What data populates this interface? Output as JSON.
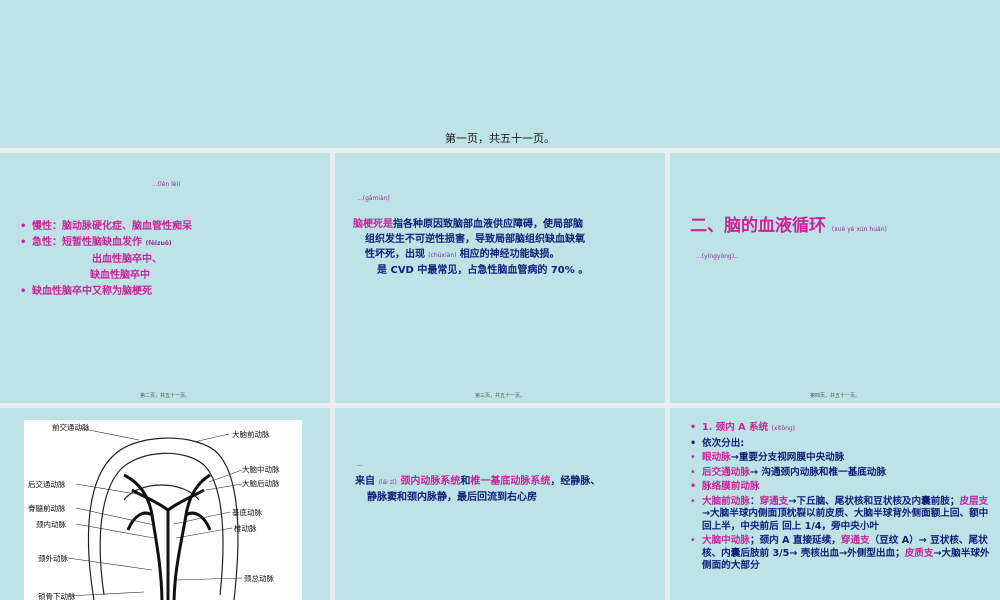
{
  "top": {
    "caption": "第一页，共五十一页。"
  },
  "slide1": {
    "note": "...(lèn lèi)",
    "items": [
      "慢性：脑动脉硬化症、脑血管性痴呆",
      "急性：短暂性脑缺血发作",
      "出血性脑卒中、",
      "缺血性脑卒中",
      "缺血性脑卒中又称为脑梗死"
    ],
    "pinyin": "(fēizuō)",
    "footer": "第二页，共五十一页。"
  },
  "slide2": {
    "note": "...(gāmiàn)",
    "term": "脑梗死是",
    "line1": "指各种原因致脑部血液供应障碍，使局部脑",
    "line2": "组织发生不可逆性损害，导致局部脑组织缺血缺氧",
    "line3a": "性坏死，出现",
    "pinyin": "(chūxiàn)",
    "line3b": "相应的神经功能缺损。",
    "line4": "是 CVD 中最常见，占急性脑血管病的 70% 。",
    "footer": "第三页，共五十一页。"
  },
  "slide3": {
    "title": "二、脑的血液循环",
    "title_pinyin": "(xuè yè xún huán)",
    "note": "...(yíngyòng)..",
    "footer": "第四页，共五十一页。"
  },
  "slide4": {
    "labels": [
      "前交通动脉",
      "大脑前动脉",
      "大脑中动脉",
      "大脑后动脉",
      "后交通动脉",
      "脊髓前动脉",
      "基底动脉",
      "颈内动脉",
      "椎动脉",
      "颈外动脉",
      "颈总动脉",
      "锁骨下动脉"
    ]
  },
  "slide5": {
    "dash": "...",
    "p1": "来自",
    "pinyin": "(lái zì)",
    "p2": "颈内动脉系统",
    "p3": "和",
    "p4": "椎一基底动脉系统",
    "p5": "，经静脉、",
    "p6": "静脉窦和颈内脉静，最后回流到右心房"
  },
  "slide6": {
    "h1": "1. 颈内 A 系统",
    "h1_pinyin": "(xìtǒng)",
    "h2": "依次分出:",
    "i1a": "眼动脉",
    "i1b": "→重要分支视网膜中央动脉",
    "i2a": "后交通动脉",
    "i2b": "→ 沟通颈内动脉和椎一基底动脉",
    "i3": "脉络膜前动脉",
    "i4a": "大脑前动脉",
    "i4b": "：",
    "i4c": "穿通支",
    "i4d": "→下丘脑、尾状核和豆状核及内囊前肢；",
    "i4e": "皮层支",
    "i4f": "→大脑半球内侧面顶枕裂以前皮质、大脑半球背外侧面额上回、额中回上半，中央前后 回上 1/4，旁中央小叶",
    "i5a": "大脑中动脉",
    "i5b": "；颈内 A 直接延续，",
    "i5c": "穿通支",
    "i5d": "（豆纹 A）→ 豆状核、尾状核、内囊后肢前 3/5→ 壳核出血→外侧型出血；",
    "i5e": "皮质支",
    "i5f": "→大脑半球外侧面的大部分"
  }
}
